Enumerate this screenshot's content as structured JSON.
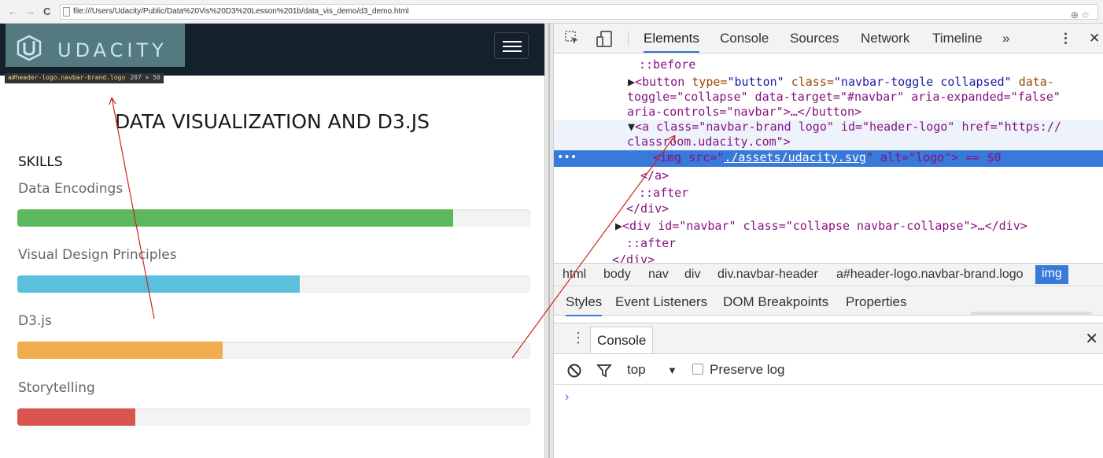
{
  "browser": {
    "back": "←",
    "forward": "→",
    "reload": "C",
    "url": "file:///Users/Udacity/Public/Data%20Vis%20D3%20Lesson%201b/data_vis_demo/d3_demo.html",
    "zoom_icon": "magnifier-icon",
    "star_icon": "star-icon",
    "zoom_glyph": "⊕",
    "star_glyph": "☆"
  },
  "page": {
    "brand": "UDACITY",
    "element_tooltip": "a#header-logo.navbar-brand.logo",
    "element_tooltip_size": "207 × 50",
    "title": "DATA VISUALIZATION AND D3.JS",
    "skills_heading": "SKILLS",
    "skills": [
      {
        "label": "Data Encodings",
        "level": 0.85,
        "color": "#5cb85c"
      },
      {
        "label": "Visual Design Principles",
        "level": 0.55,
        "color": "#5bc0de"
      },
      {
        "label": "D3.js",
        "level": 0.4,
        "color": "#f0ad4e"
      },
      {
        "label": "Storytelling",
        "level": 0.23,
        "color": "#d9534f"
      }
    ]
  },
  "devtools": {
    "tabs": [
      "Elements",
      "Console",
      "Sources",
      "Network",
      "Timeline"
    ],
    "more_tabs": "»",
    "menu_glyph": "⋮",
    "close_glyph": "✕",
    "dom": {
      "before": "::before",
      "button_line1_tag": "<button",
      "button_line1_attrs": " type=\"button\" class=\"navbar-toggle collapsed\" data-",
      "button_line2": "toggle=\"collapse\" data-target=\"#navbar\" aria-expanded=\"false\"",
      "button_line3": "aria-controls=\"navbar\">…</button>",
      "a_line1": "<a class=\"navbar-brand logo\" id=\"header-logo\" href=\"https://",
      "a_line2": "classroom.udacity.com\">",
      "img_open": "<img src=\"",
      "img_src": "./assets/udacity.svg",
      "img_rest": "\" alt=\"logo\"> == $0",
      "a_close": "</a>",
      "after1": "::after",
      "div_close1": "</div>",
      "div_navbar": "<div id=\"navbar\" class=\"collapse navbar-collapse\">…</div>",
      "after2": "::after",
      "div_close2": "</div>",
      "dots": "•••"
    },
    "breadcrumbs": [
      "html",
      "body",
      "nav",
      "div",
      "div.navbar-header",
      "a#header-logo.navbar-brand.logo",
      "img"
    ],
    "subtabs": [
      "Styles",
      "Event Listeners",
      "DOM Breakpoints",
      "Properties"
    ],
    "drawer": {
      "tab": "Console",
      "filter_context": "top",
      "preserve_log": "Preserve log",
      "prompt": "›"
    }
  }
}
